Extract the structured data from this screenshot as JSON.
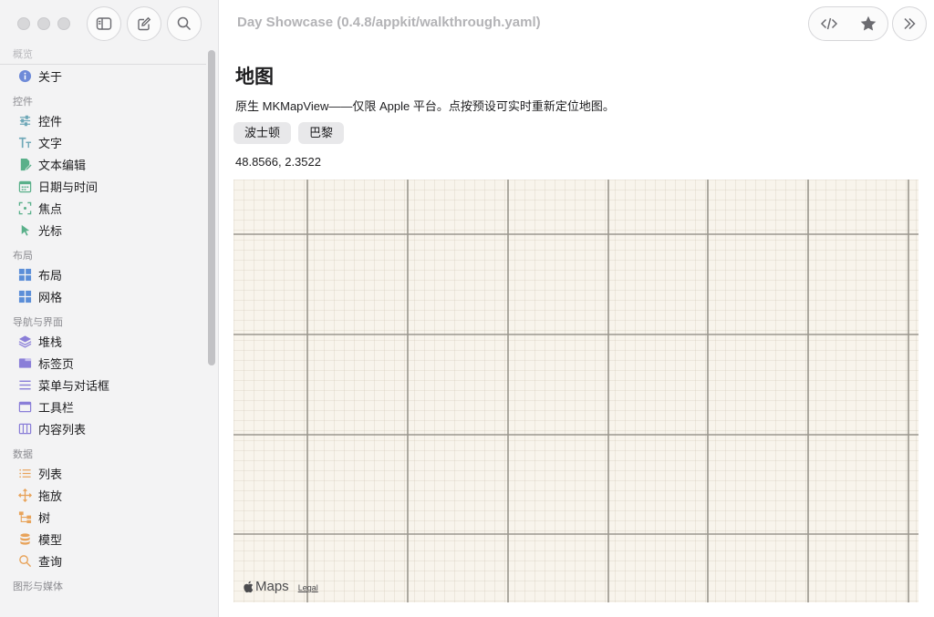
{
  "window": {
    "title": "Day Showcase (0.4.8/appkit/walkthrough.yaml)"
  },
  "sidebar": {
    "sections": [
      {
        "label": "概览",
        "items": [
          {
            "label": "关于",
            "icon": "info-icon",
            "color": "#6e8ad8"
          }
        ]
      },
      {
        "label": "控件",
        "items": [
          {
            "label": "控件",
            "icon": "sliders-icon",
            "color": "#6fa8b8"
          },
          {
            "label": "文字",
            "icon": "text-icon",
            "color": "#6fa8b8"
          },
          {
            "label": "文本编辑",
            "icon": "edit-doc-icon",
            "color": "#5ab08a"
          },
          {
            "label": "日期与时间",
            "icon": "calendar-icon",
            "color": "#5ab08a"
          },
          {
            "label": "焦点",
            "icon": "focus-icon",
            "color": "#5ab08a"
          },
          {
            "label": "光标",
            "icon": "cursor-icon",
            "color": "#5ab08a"
          }
        ]
      },
      {
        "label": "布局",
        "items": [
          {
            "label": "布局",
            "icon": "layout-icon",
            "color": "#5b8ed8"
          },
          {
            "label": "网格",
            "icon": "grid-icon",
            "color": "#5b8ed8"
          }
        ]
      },
      {
        "label": "导航与界面",
        "items": [
          {
            "label": "堆栈",
            "icon": "stack-icon",
            "color": "#8a7ed8"
          },
          {
            "label": "标签页",
            "icon": "tabs-icon",
            "color": "#8a7ed8"
          },
          {
            "label": "菜单与对话框",
            "icon": "menu-icon",
            "color": "#8a7ed8"
          },
          {
            "label": "工具栏",
            "icon": "toolbar-icon",
            "color": "#8a7ed8"
          },
          {
            "label": "内容列表",
            "icon": "columns-icon",
            "color": "#8a7ed8"
          }
        ]
      },
      {
        "label": "数据",
        "items": [
          {
            "label": "列表",
            "icon": "list-icon",
            "color": "#e8a35a"
          },
          {
            "label": "拖放",
            "icon": "move-icon",
            "color": "#e8a35a"
          },
          {
            "label": "树",
            "icon": "tree-icon",
            "color": "#e8a35a"
          },
          {
            "label": "模型",
            "icon": "database-icon",
            "color": "#e8a35a"
          },
          {
            "label": "查询",
            "icon": "search-icon",
            "color": "#e8a35a"
          }
        ]
      },
      {
        "label": "图形与媒体",
        "items": []
      }
    ]
  },
  "main": {
    "title": "地图",
    "description": "原生 MKMapView——仅限 Apple 平台。点按预设可实时重新定位地图。",
    "presets": [
      "波士顿",
      "巴黎"
    ],
    "coordinates": "48.8566, 2.3522",
    "map": {
      "brand": "Maps",
      "legal": "Legal"
    }
  }
}
